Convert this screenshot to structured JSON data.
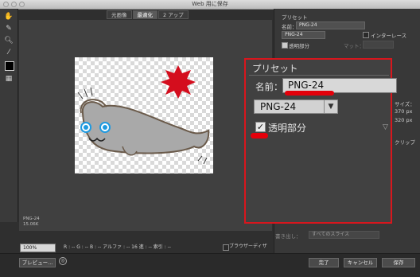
{
  "window": {
    "title": "Web 用に保存"
  },
  "view_tabs": [
    {
      "label": "元画像",
      "active": false
    },
    {
      "label": "最適化",
      "active": true
    },
    {
      "label": "2 アップ",
      "active": false
    }
  ],
  "tools": [
    "hand-tool",
    "slice-select-tool",
    "zoom-tool",
    "eyedropper-tool"
  ],
  "image_info": {
    "format": "PNG-24",
    "size": "15.06K"
  },
  "right_panel": {
    "preset_label": "プリセット",
    "name_label": "名前：",
    "name_value": "PNG-24",
    "format_value": "PNG-24",
    "interlace_label": "インターレース",
    "transparency_label": "透明部分",
    "matte_label": "マット：",
    "matte_value": "",
    "size_label": "サイズ：",
    "width_value": "370 px",
    "height_value": "320 px",
    "clip_label": "クリップ",
    "export_label": "書き出し：",
    "export_value": "すべてのスライス"
  },
  "callout": {
    "title": "プリセット",
    "name_label": "名前：",
    "name_value": "PNG-24",
    "format_value": "PNG-24",
    "transparency_label": "透明部分",
    "transparency_checked": true
  },
  "status": {
    "zoom": "100%",
    "pixel_info": "R : --   G : --   B : --   アルファ : --   16 進 : --   索引 : --",
    "browser_dither": "ブラウザーディザ"
  },
  "buttons": {
    "preview": "プレビュー...",
    "done": "完了",
    "cancel": "キャンセル",
    "save": "保存"
  },
  "colors": {
    "highlight": "#d8161d",
    "marker": "#e3000b"
  }
}
